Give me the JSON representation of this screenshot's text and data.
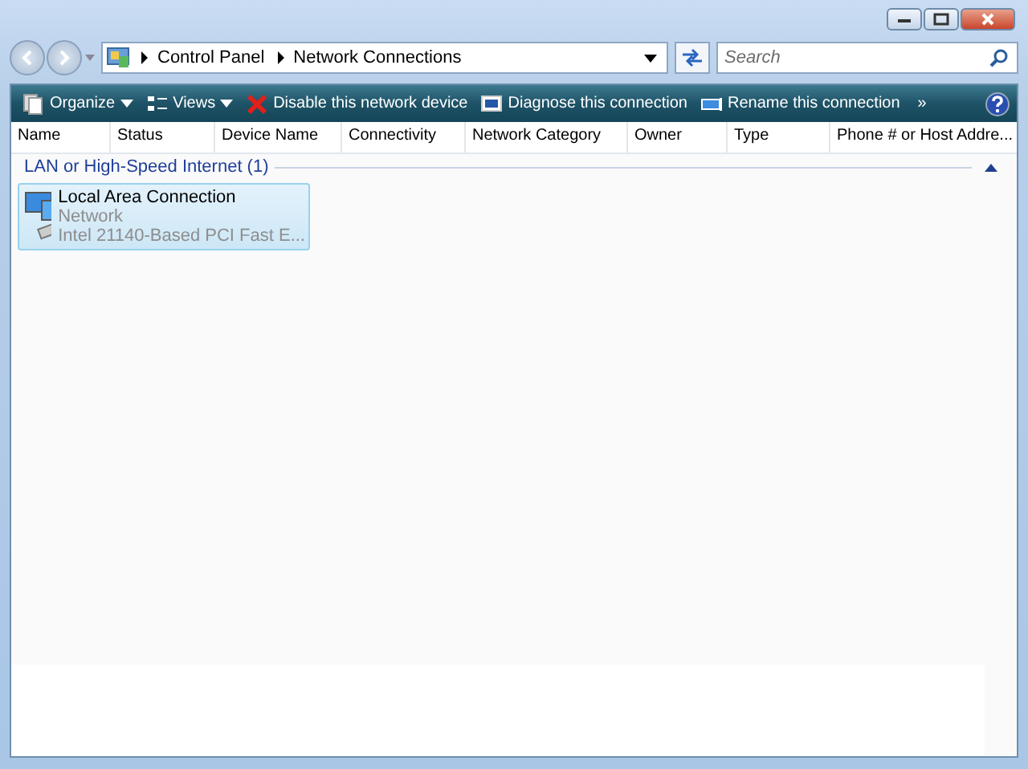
{
  "address": {
    "crumbs": [
      "Control Panel",
      "Network Connections"
    ]
  },
  "search": {
    "placeholder": "Search"
  },
  "toolbar": {
    "items": [
      {
        "kind": "menu",
        "label": "Organize"
      },
      {
        "kind": "menu",
        "label": "Views"
      },
      {
        "kind": "button",
        "label": "Disable this network device"
      },
      {
        "kind": "button",
        "label": "Diagnose this connection"
      },
      {
        "kind": "button",
        "label": "Rename this connection"
      }
    ],
    "overflow": "»"
  },
  "columns": [
    "Name",
    "Status",
    "Device Name",
    "Connectivity",
    "Network Category",
    "Owner",
    "Type",
    "Phone # or Host Addre..."
  ],
  "groups": [
    {
      "title": "LAN or High-Speed Internet (1)",
      "expanded": true,
      "items": [
        {
          "name": "Local Area Connection",
          "status": "Network",
          "device": "Intel 21140-Based PCI Fast E...",
          "selected": true
        }
      ]
    }
  ]
}
